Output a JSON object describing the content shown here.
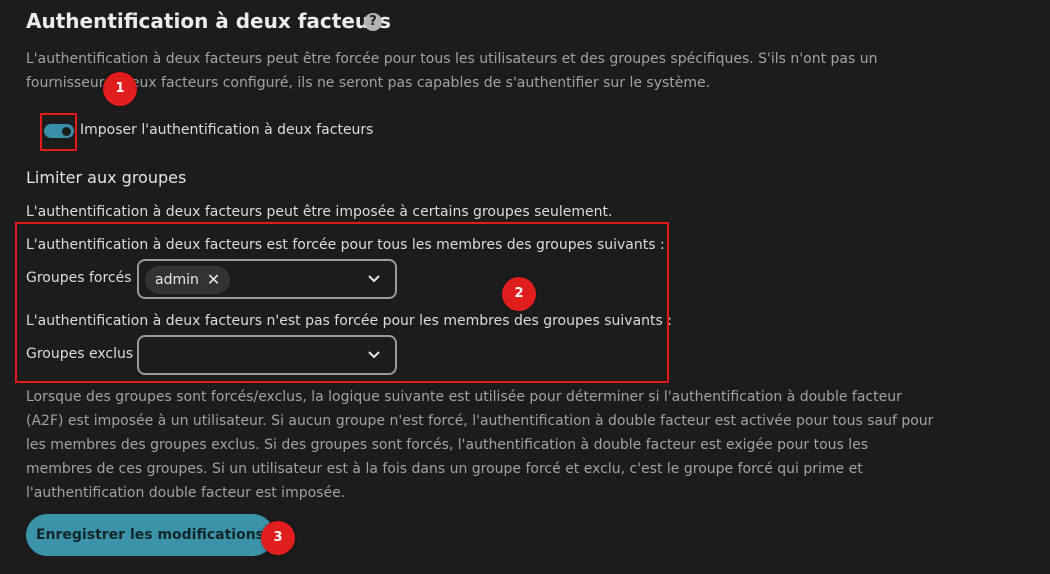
{
  "section": {
    "title": "Authentification à deux facteurs",
    "help_icon": "?",
    "description": "L'authentification à deux facteurs peut être forcée pour tous les utilisateurs et des groupes spécifiques. S'ils n'ont pas un fournisseur à deux facteurs configuré, ils ne seront pas capables de s'authentifier sur le système."
  },
  "enforce": {
    "label": "Imposer l'authentification à deux facteurs",
    "enabled": true
  },
  "groups": {
    "heading": "Limiter aux groupes",
    "intro": "L'authentification à deux facteurs peut être imposée à certains groupes seulement.",
    "forced_description": "L'authentification à deux facteurs est forcée pour tous les membres des groupes suivants :",
    "forced_label": "Groupes forcés",
    "forced_selected": [
      "admin"
    ],
    "excluded_description": "L'authentification à deux facteurs n'est pas forcée pour les membres des groupes suivants :",
    "excluded_label": "Groupes exclus",
    "excluded_selected": []
  },
  "logic_text": "Lorsque des groupes sont forcés/exclus, la logique suivante est utilisée pour déterminer si l'authentification à double facteur (A2F) est imposée à un utilisateur. Si aucun groupe n'est forcé, l'authentification à double facteur est activée pour tous sauf pour les membres des groupes exclus. Si des groupes sont forcés, l'authentification à double facteur est exigée pour tous les membres de ces groupes. Si un utilisateur est à la fois dans un groupe forcé et exclu, c'est le groupe forcé qui prime et l'authentification double facteur est imposée.",
  "save_button": "Enregistrer les modifications",
  "annotations": {
    "badge_1": "1",
    "badge_2": "2",
    "badge_3": "3"
  },
  "icons": {
    "chip_remove": "✕",
    "chevron": "chevron-down-icon"
  },
  "colors": {
    "background": "#1c1c1c",
    "accent": "#3b93aa",
    "highlight": "#e11b1b"
  }
}
